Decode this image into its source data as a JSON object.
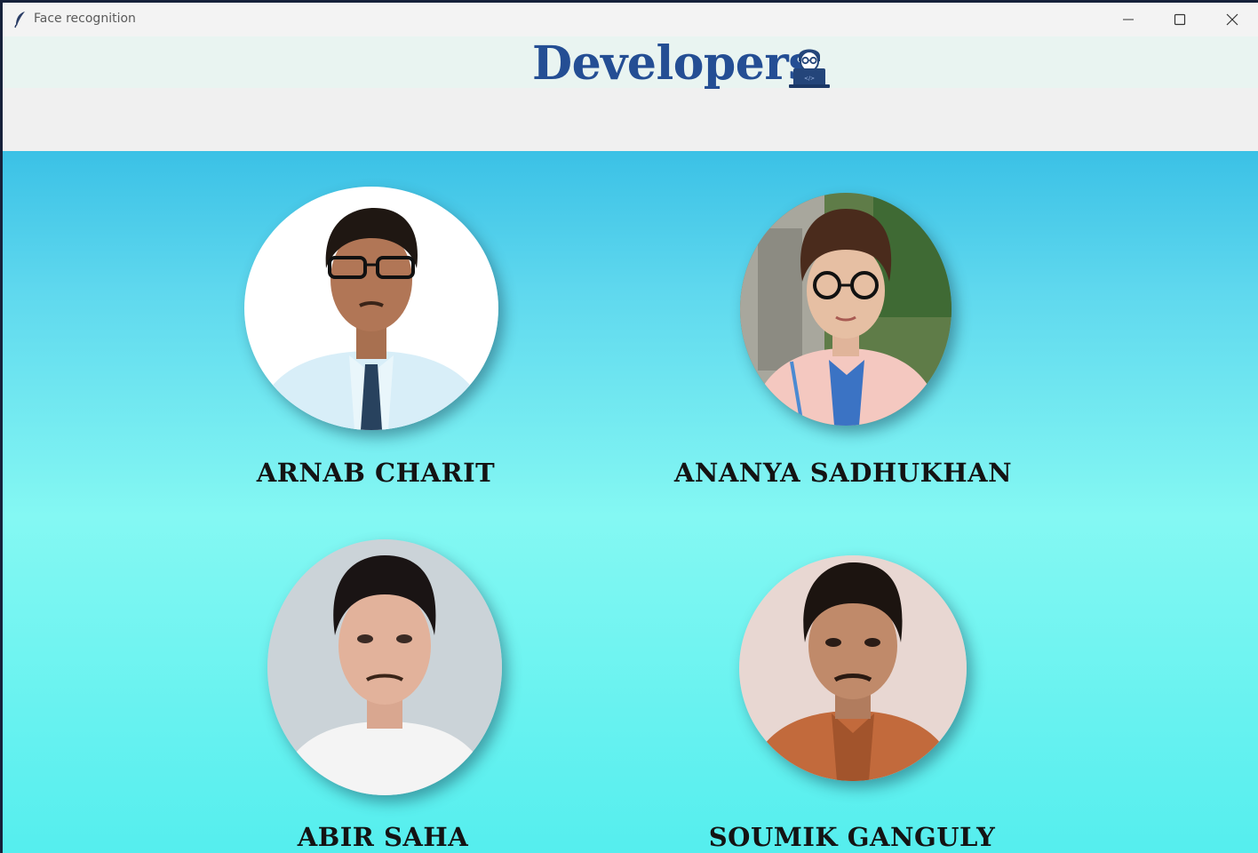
{
  "window": {
    "title": "Face recognition",
    "controls": [
      "minimize-icon",
      "maximize-icon",
      "close-icon"
    ]
  },
  "header": {
    "title": "Developers",
    "icon": "developer-laptop-icon"
  },
  "developers": [
    {
      "name": "ARNAB CHARIT"
    },
    {
      "name": "ANANYA SADHUKHAN"
    },
    {
      "name": "ABIR SAHA"
    },
    {
      "name": "SOUMIK GANGULY"
    }
  ],
  "colors": {
    "title": "#244e94",
    "gradient_top": "#3bc1e6",
    "gradient_mid": "#84f8f3",
    "gradient_bottom": "#55eeee",
    "name_text": "#141414"
  }
}
